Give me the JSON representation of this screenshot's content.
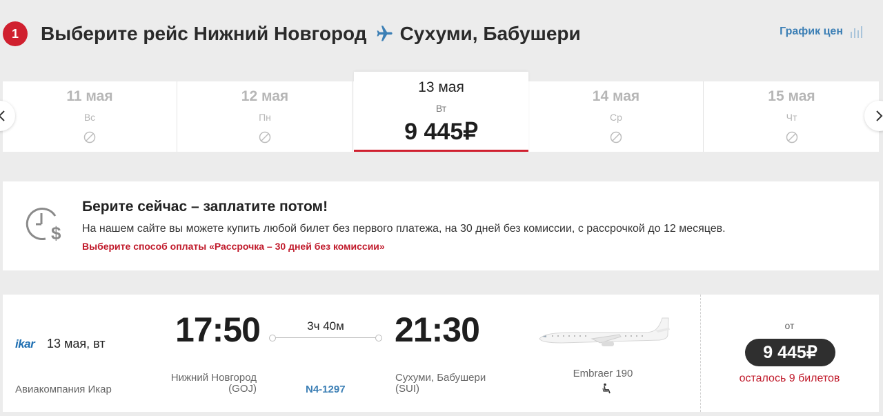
{
  "header": {
    "step": "1",
    "title_prefix": "Выберите рейс Нижний Новгород",
    "title_suffix": "Сухуми, Бабушери",
    "price_chart_link": "График цен"
  },
  "dates": [
    {
      "date": "11 мая",
      "weekday": "Вс",
      "available": false
    },
    {
      "date": "12 мая",
      "weekday": "Пн",
      "available": false
    },
    {
      "date": "13 мая",
      "weekday": "Вт",
      "price": "9 445₽",
      "available": true
    },
    {
      "date": "14 мая",
      "weekday": "Ср",
      "available": false
    },
    {
      "date": "15 мая",
      "weekday": "Чт",
      "available": false
    }
  ],
  "promo": {
    "title": "Берите сейчас – заплатите потом!",
    "text": "На нашем сайте вы можете купить любой билет без первого платежа, на 30 дней без комиссии, с рассрочкой до 12 месяцев.",
    "link": "Выберите способ оплаты «Рассрочка – 30 дней без комиссии»"
  },
  "flight": {
    "airline_logo": "ikar",
    "date": "13 мая, вт",
    "airline": "Авиакомпания Икар",
    "departure_time": "17:50",
    "arrival_time": "21:30",
    "duration": "3ч 40м",
    "departure_city": "Нижний Новгород",
    "departure_code": "(GOJ)",
    "arrival_city": "Сухуми, Бабушери",
    "arrival_code": "(SUI)",
    "flight_number": "N4-1297",
    "aircraft": "Embraer 190",
    "price_from_label": "от",
    "price": "9 445₽",
    "seats_left": "осталось 9 билетов"
  },
  "colors": {
    "accent_red": "#d0202f",
    "link_blue": "#3c7fb5",
    "price_pill": "#2f2f2f"
  }
}
